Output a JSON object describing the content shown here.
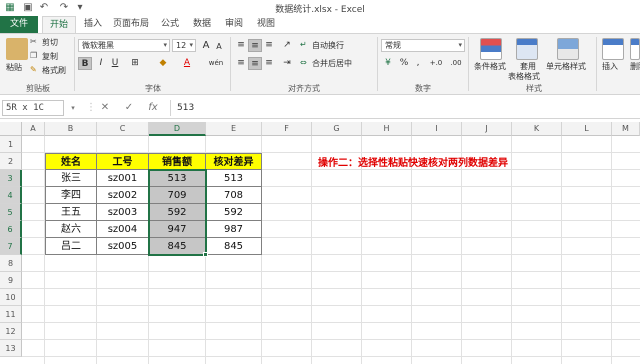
{
  "window": {
    "title": "数据统计.xlsx - Excel"
  },
  "quick_access": [
    "save-icon",
    "undo-icon",
    "redo-icon",
    "customize-icon"
  ],
  "tabs": [
    {
      "label": "文件"
    },
    {
      "label": "开始"
    },
    {
      "label": "插入"
    },
    {
      "label": "页面布局"
    },
    {
      "label": "公式"
    },
    {
      "label": "数据"
    },
    {
      "label": "审阅"
    },
    {
      "label": "视图"
    }
  ],
  "ribbon": {
    "clipboard": {
      "paste": "粘贴",
      "cut": "剪切",
      "copy": "复制",
      "format_painter": "格式刷",
      "label": "剪贴板"
    },
    "font": {
      "name": "微软雅黑",
      "size": "12",
      "bold": "B",
      "italic": "I",
      "underline": "U",
      "label": "字体",
      "grow": "A",
      "shrink": "A",
      "wen": "wén"
    },
    "alignment": {
      "wrap": "自动换行",
      "merge": "合并后居中",
      "label": "对齐方式"
    },
    "number": {
      "format": "常规",
      "label": "数字",
      "percent": "%",
      "comma": ",",
      "inc_decimal": "+.0",
      "dec_decimal": ".00"
    },
    "styles": {
      "conditional": "条件格式",
      "table": "套用",
      "table2": "表格格式",
      "cell": "单元格样式",
      "label": "样式"
    },
    "cells": {
      "insert": "插入",
      "delete": "删除"
    }
  },
  "formula_bar": {
    "name_box": "5R x 1C",
    "cancel": "✕",
    "enter": "✓",
    "fx": "fx",
    "content": "513"
  },
  "columns": [
    "A",
    "B",
    "C",
    "D",
    "E",
    "F",
    "G",
    "H",
    "I",
    "J",
    "K",
    "L",
    "M"
  ],
  "rows": [
    "1",
    "2",
    "3",
    "4",
    "5",
    "6",
    "7",
    "8",
    "9",
    "10",
    "11",
    "12",
    "13"
  ],
  "table": {
    "headers": [
      "姓名",
      "工号",
      "销售额",
      "核对差异"
    ],
    "rows": [
      [
        "张三",
        "sz001",
        "513",
        "513"
      ],
      [
        "李四",
        "sz002",
        "709",
        "708"
      ],
      [
        "王五",
        "sz003",
        "592",
        "592"
      ],
      [
        "赵六",
        "sz004",
        "947",
        "987"
      ],
      [
        "吕二",
        "sz005",
        "845",
        "845"
      ]
    ]
  },
  "note": "操作二：选择性粘贴快速核对两列数据差异",
  "colors": {
    "accent": "#217346",
    "header_fill": "#ffff00",
    "highlight": "#c6c6c6",
    "note": "#e00000"
  }
}
